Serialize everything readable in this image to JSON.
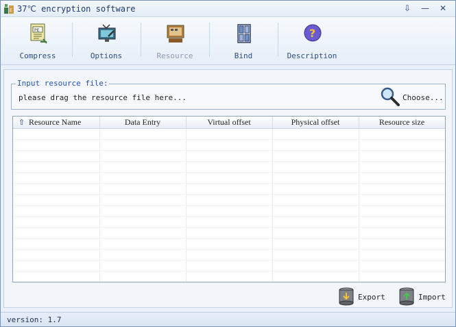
{
  "window": {
    "title": "37℃ encryption software",
    "controls": {
      "restore": "⇩",
      "minimize": "—",
      "close": "✕"
    }
  },
  "toolbar": {
    "items": [
      {
        "label": "Compress",
        "icon": "pe-document-icon",
        "enabled": true
      },
      {
        "label": "Options",
        "icon": "monitor-settings-icon",
        "enabled": true
      },
      {
        "label": "Resource",
        "icon": "resource-folder-icon",
        "enabled": false
      },
      {
        "label": "Bind",
        "icon": "bind-blocks-icon",
        "enabled": true
      },
      {
        "label": "Description",
        "icon": "help-question-icon",
        "enabled": true
      }
    ]
  },
  "input_group": {
    "legend": "Input resource file:",
    "hint": "please drag the resource file here...",
    "choose_label": "Choose..."
  },
  "resource_table": {
    "columns": [
      "Resource Name",
      "Data Entry",
      "Virtual offset",
      "Physical offset",
      "Resource size"
    ],
    "sort_icon": "sort-up-arrow-icon",
    "rows": []
  },
  "actions": {
    "export_label": "Export",
    "import_label": "Import"
  },
  "status": {
    "version_text": "version: 1.7"
  },
  "colors": {
    "accent": "#2854a8",
    "toolbar_label": "#2b4d80",
    "disabled": "#8c9bb0"
  }
}
